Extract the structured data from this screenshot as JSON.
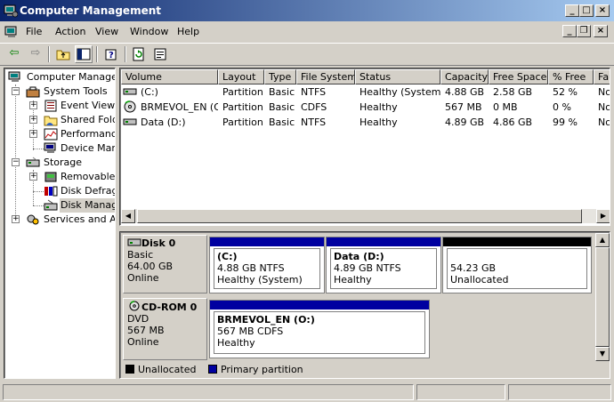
{
  "window": {
    "title": "Computer Management",
    "colors": {
      "title_start": "#0a246a",
      "title_end": "#a6caf0",
      "primary_partition": "#0000a0",
      "unallocated": "#000000"
    }
  },
  "menu": [
    "File",
    "Action",
    "View",
    "Window",
    "Help"
  ],
  "toolbar": {
    "icons": [
      "back-icon",
      "forward-icon",
      "up-folder-icon",
      "show-hide-tree-icon",
      "help-icon",
      "refresh-icon",
      "properties-icon"
    ]
  },
  "tree": {
    "root": "Computer Management (Local)",
    "items": [
      {
        "label": "System Tools",
        "level": 1,
        "expanded": true
      },
      {
        "label": "Event Viewer",
        "level": 2
      },
      {
        "label": "Shared Folders",
        "level": 2
      },
      {
        "label": "Performance Logs and Alerts",
        "level": 2
      },
      {
        "label": "Device Manager",
        "level": 2
      },
      {
        "label": "Storage",
        "level": 1,
        "expanded": true
      },
      {
        "label": "Removable Storage",
        "level": 2
      },
      {
        "label": "Disk Defragmenter",
        "level": 2
      },
      {
        "label": "Disk Management",
        "level": 2,
        "selected": true
      },
      {
        "label": "Services and Applications",
        "level": 1
      }
    ]
  },
  "volumes": {
    "columns": [
      "Volume",
      "Layout",
      "Type",
      "File System",
      "Status",
      "Capacity",
      "Free Space",
      "% Free",
      "Fault Tolerance"
    ],
    "rows": [
      [
        "(C:)",
        "Partition",
        "Basic",
        "NTFS",
        "Healthy (System)",
        "4.88 GB",
        "2.58 GB",
        "52 %",
        "No"
      ],
      [
        "BRMEVOL_EN (O:)",
        "Partition",
        "Basic",
        "CDFS",
        "Healthy",
        "567 MB",
        "0 MB",
        "0 %",
        "No"
      ],
      [
        "Data (D:)",
        "Partition",
        "Basic",
        "NTFS",
        "Healthy",
        "4.89 GB",
        "4.86 GB",
        "99 %",
        "No"
      ]
    ]
  },
  "disks": [
    {
      "name": "Disk 0",
      "type": "Basic",
      "size": "64.00 GB",
      "status": "Online",
      "partitions": [
        {
          "name": "(C:)",
          "info": "4.88 GB NTFS",
          "status": "Healthy (System)",
          "kind": "primary"
        },
        {
          "name": "Data  (D:)",
          "info": "4.89 GB NTFS",
          "status": "Healthy",
          "kind": "primary"
        },
        {
          "name": "",
          "info": "54.23 GB",
          "status": "Unallocated",
          "kind": "unallocated"
        }
      ]
    },
    {
      "name": "CD-ROM 0",
      "type": "DVD",
      "size": "567 MB",
      "status": "Online",
      "partitions": [
        {
          "name": "BRMEVOL_EN  (O:)",
          "info": "567 MB CDFS",
          "status": "Healthy",
          "kind": "primary"
        }
      ]
    }
  ],
  "legend": {
    "unallocated": "Unallocated",
    "primary": "Primary partition"
  }
}
